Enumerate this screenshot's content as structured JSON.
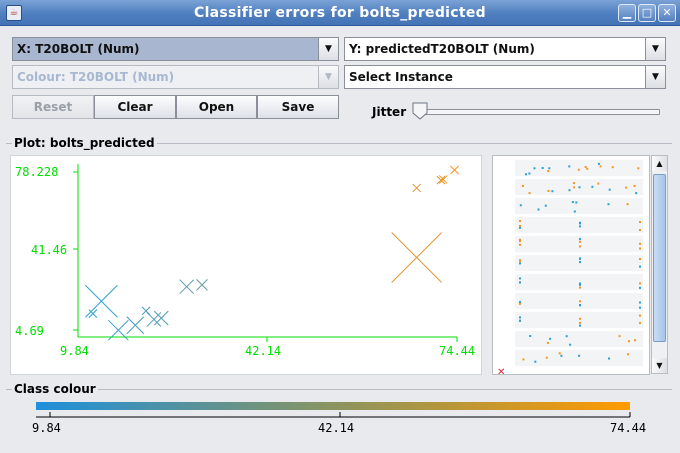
{
  "window": {
    "title": "Classifier errors for bolts_predicted",
    "controls": [
      "minimize",
      "maximize",
      "close"
    ]
  },
  "x_axis_select": {
    "value": "X: T20BOLT (Num)"
  },
  "y_axis_select": {
    "value": "Y: predictedT20BOLT (Num)"
  },
  "colour_select": {
    "value": "Colour: T20BOLT (Num)",
    "enabled": false
  },
  "instance_select": {
    "value": "Select Instance"
  },
  "buttons": {
    "reset": "Reset",
    "clear": "Clear",
    "open": "Open",
    "save": "Save"
  },
  "jitter": {
    "label": "Jitter",
    "value": 0
  },
  "plot": {
    "group_title": "Plot: bolts_predicted",
    "x_ticks": [
      "9.84",
      "42.14",
      "74.44"
    ],
    "y_ticks": [
      "78.228",
      "41.46",
      "4.69"
    ]
  },
  "class_colour": {
    "group_title": "Class colour",
    "ticks": [
      "9.84",
      "42.14",
      "74.44"
    ],
    "gradient_start": "#1e90dc",
    "gradient_end": "#ff9a00"
  },
  "colors": {
    "axis": "#00dd00",
    "low": "#2a9fd6",
    "high": "#f7941d"
  },
  "chart_data": {
    "type": "scatter",
    "title": "Plot: bolts_predicted",
    "xlabel": "T20BOLT",
    "ylabel": "predictedT20BOLT",
    "xlim": [
      9.84,
      74.44
    ],
    "ylim": [
      4.69,
      78.228
    ],
    "points": [
      {
        "x": 11.5,
        "y": 17.5,
        "size": 5
      },
      {
        "x": 14.5,
        "y": 4.6,
        "size": 3
      },
      {
        "x": 17.5,
        "y": 6.8,
        "size": 2.5
      },
      {
        "x": 20.8,
        "y": 9.4,
        "size": 2
      },
      {
        "x": 22.1,
        "y": 10.0,
        "size": 2
      },
      {
        "x": 19.4,
        "y": 13.2,
        "size": 1
      },
      {
        "x": 10.0,
        "y": 12.0,
        "size": 1
      },
      {
        "x": 26.6,
        "y": 24.0,
        "size": 2
      },
      {
        "x": 29.3,
        "y": 24.8,
        "size": 1.5
      },
      {
        "x": 67.3,
        "y": 37.0,
        "size": 8
      },
      {
        "x": 67.3,
        "y": 68.0,
        "size": 1
      },
      {
        "x": 71.6,
        "y": 71.5,
        "size": 1
      },
      {
        "x": 72.0,
        "y": 71.8,
        "size": 1
      },
      {
        "x": 74.0,
        "y": 76.0,
        "size": 1
      }
    ]
  }
}
